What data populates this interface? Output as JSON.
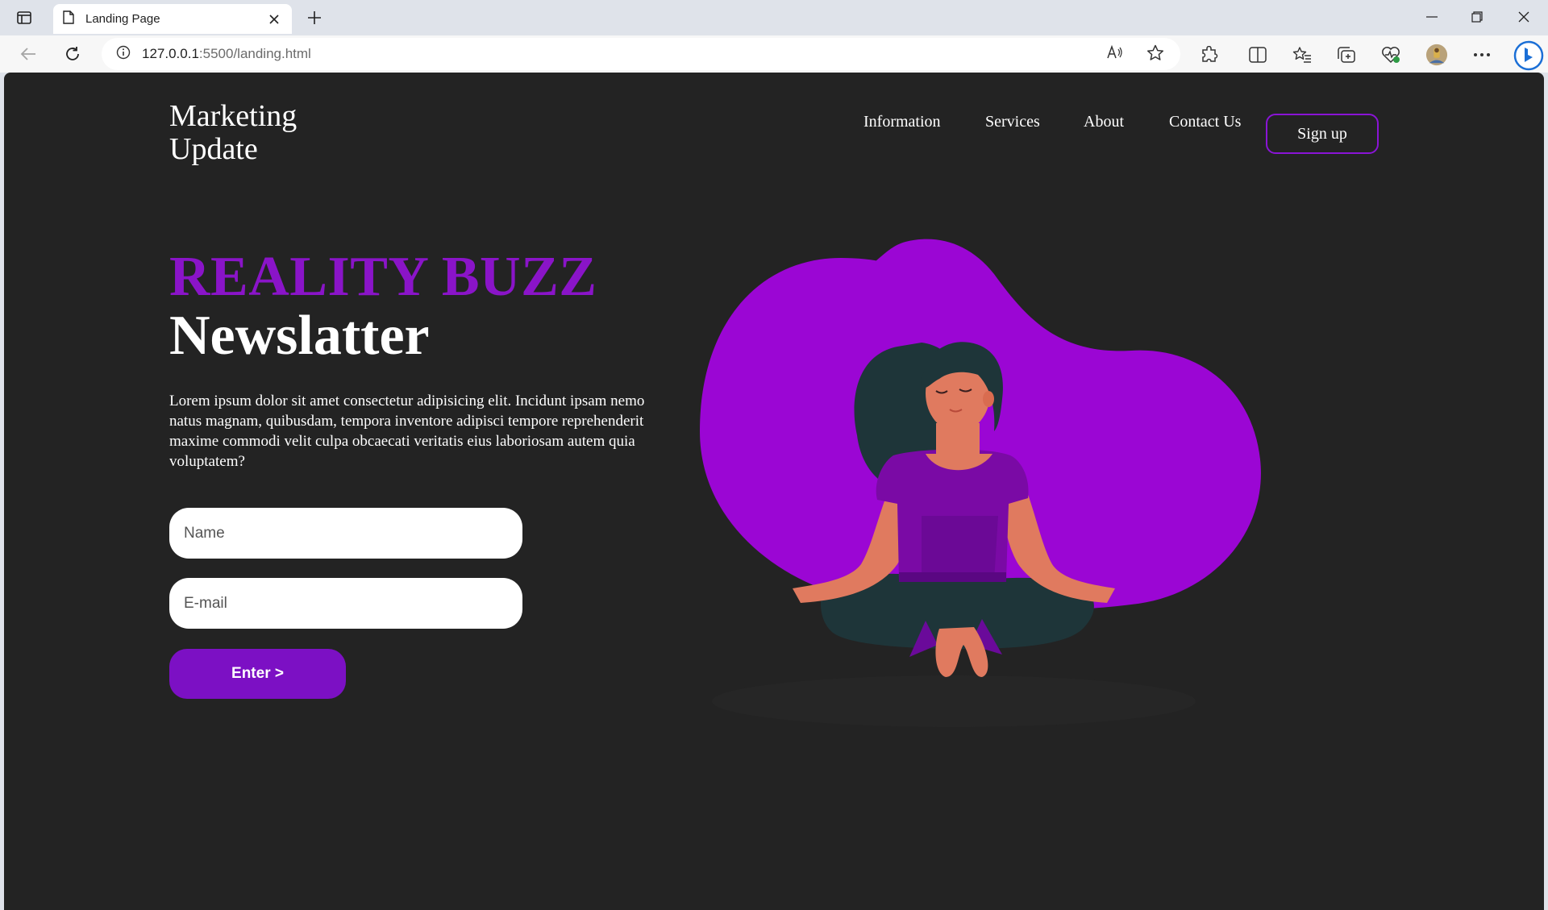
{
  "browser": {
    "tab_title": "Landing Page",
    "url_host": "127.0.0.1",
    "url_path": ":5500/landing.html",
    "icons": [
      "tab-actions-icon",
      "page-icon",
      "close-icon",
      "plus-icon",
      "minimize-icon",
      "restore-icon",
      "close-window-icon",
      "back-icon",
      "refresh-icon",
      "info-icon",
      "read-aloud-icon",
      "favorite-star-icon",
      "extensions-icon",
      "split-screen-icon",
      "favorites-icon",
      "collections-icon",
      "browser-essentials-icon",
      "profile-icon",
      "more-icon",
      "copilot-icon"
    ]
  },
  "header": {
    "logo_line1": "Marketing",
    "logo_line2": "Update",
    "nav": [
      "Information",
      "Services",
      "About",
      "Contact Us"
    ],
    "signup_label": "Sign up"
  },
  "hero": {
    "title_accent": "REALITY BUZZ",
    "title_main": "Newslatter",
    "body": "Lorem ipsum dolor sit amet consectetur adipisicing elit. Incidunt ipsam nemo natus magnam, quibusdam, tempora inventore adipisci tempore reprehenderit maxime commodi velit culpa obcaecati veritatis eius laboriosam autem quia voluptatem?"
  },
  "form": {
    "name_placeholder": "Name",
    "email_placeholder": "E-mail",
    "enter_label": "Enter >"
  },
  "colors": {
    "page_bg": "#232323",
    "accent": "#8a14c8",
    "blob": "#9b06d4",
    "button": "#7c10c4"
  }
}
